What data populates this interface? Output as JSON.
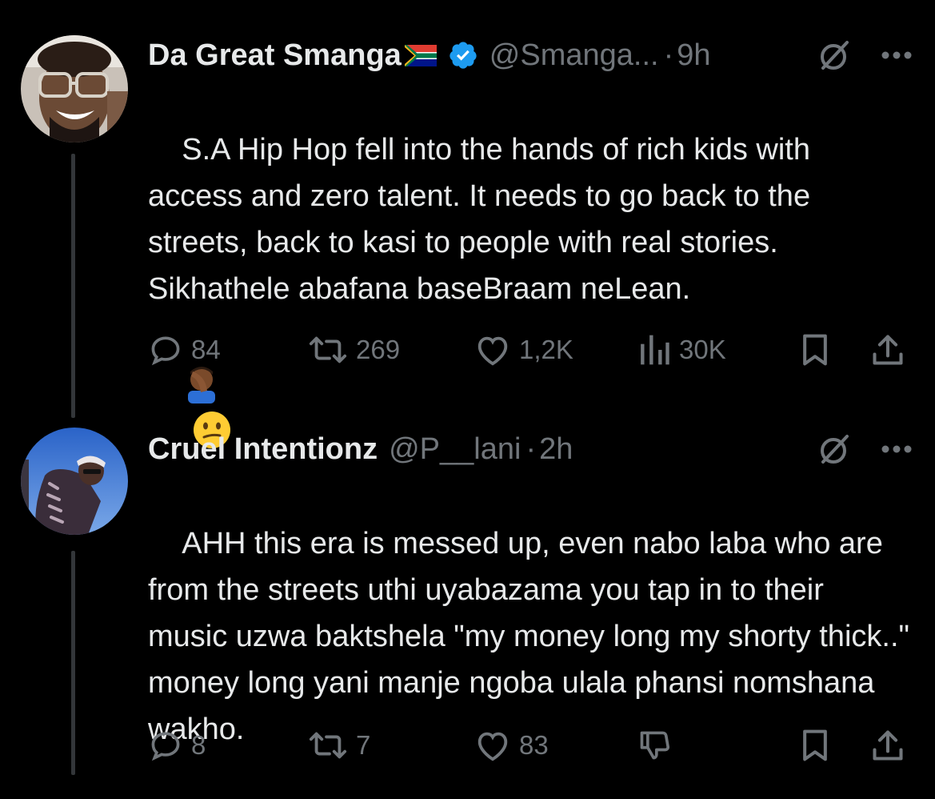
{
  "tweets": [
    {
      "author": {
        "display_name": "Da Great Smanga",
        "handle": "@Smanga...",
        "verified": true,
        "flag": "south-africa-flag-emoji"
      },
      "time_separator": "·",
      "time": "9h",
      "text": "S.A Hip Hop fell into the hands of rich kids with access and zero talent. It needs to go back to the streets, back to kasi to people with real stories. Sikhathele abafana baseBraam neLean.",
      "emojis": [
        "man-facepalming-emoji",
        "confused-face-emoji"
      ],
      "stats": {
        "replies": "84",
        "reposts": "269",
        "likes": "1,2K",
        "views": "30K"
      }
    },
    {
      "author": {
        "display_name": "Cruel Intentionz",
        "handle": "@P__lani",
        "verified": false
      },
      "time_separator": "·",
      "time": "2h",
      "text": "AHH this era is messed up, even nabo laba who are from the streets uthi uyabazama you tap in to their music uzwa baktshela \"my money long my shorty thick..\" money long yani manje ngoba ulala phansi nomshana wakho.",
      "stats": {
        "replies": "8",
        "reposts": "7",
        "likes": "83"
      }
    }
  ],
  "icons": {
    "reply": "speech-bubble-icon",
    "repost": "retweet-arrows-icon",
    "like": "heart-icon",
    "views": "bar-chart-icon",
    "bookmark": "bookmark-icon",
    "share": "share-upload-icon",
    "grok": "grok-slash-circle-icon",
    "more": "ellipsis-icon",
    "downvote": "thumbs-down-icon"
  },
  "colors": {
    "background": "#000000",
    "primary_text": "#e7e9ea",
    "secondary_text": "#71767b",
    "verified_blue": "#1d9bf0",
    "thread_line": "#333639"
  }
}
